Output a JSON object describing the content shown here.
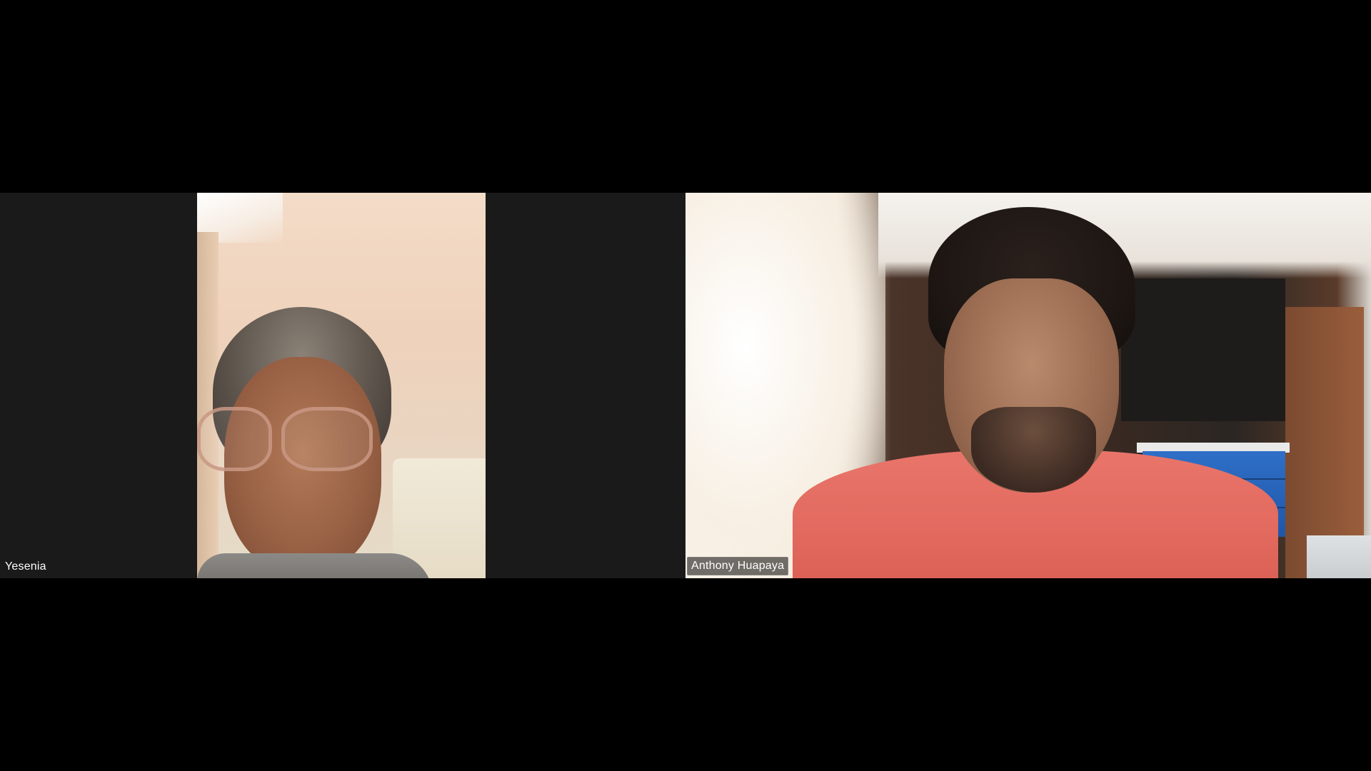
{
  "app": {
    "layout": "gallery-view"
  },
  "participants": [
    {
      "name": "Yesenia"
    },
    {
      "name": "Anthony Huapaya"
    }
  ],
  "colors": {
    "background": "#000000",
    "tile_background": "#1a1a1a",
    "label_text": "#ffffff"
  }
}
